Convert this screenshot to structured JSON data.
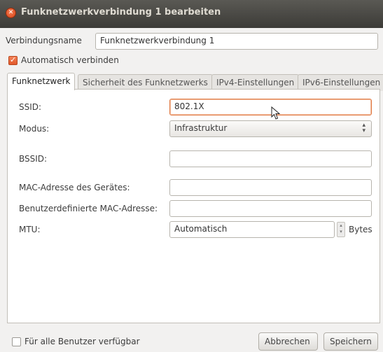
{
  "window": {
    "title": "Funknetzwerkverbindung 1 bearbeiten"
  },
  "connection": {
    "name_label": "Verbindungsname",
    "name_value": "Funknetzwerkverbindung 1"
  },
  "auto_connect": {
    "label": "Automatisch verbinden",
    "checked": true
  },
  "tabs": [
    {
      "label": "Funknetzwerk",
      "active": true
    },
    {
      "label": "Sicherheit des Funknetzwerks",
      "active": false
    },
    {
      "label": "IPv4-Einstellungen",
      "active": false
    },
    {
      "label": "IPv6-Einstellungen",
      "active": false
    }
  ],
  "form": {
    "ssid_label": "SSID:",
    "ssid_value": "802.1X",
    "mode_label": "Modus:",
    "mode_value": "Infrastruktur",
    "bssid_label": "BSSID:",
    "bssid_value": "",
    "mac_label": "MAC-Adresse des Gerätes:",
    "mac_value": "",
    "custom_mac_label": "Benutzerdefinierte MAC-Adresse:",
    "custom_mac_value": "",
    "mtu_label": "MTU:",
    "mtu_value": "Automatisch",
    "mtu_unit": "Bytes"
  },
  "footer": {
    "all_users_label": "Für alle Benutzer verfügbar",
    "all_users_checked": false,
    "cancel_label": "Abbrechen",
    "save_label": "Speichern"
  }
}
